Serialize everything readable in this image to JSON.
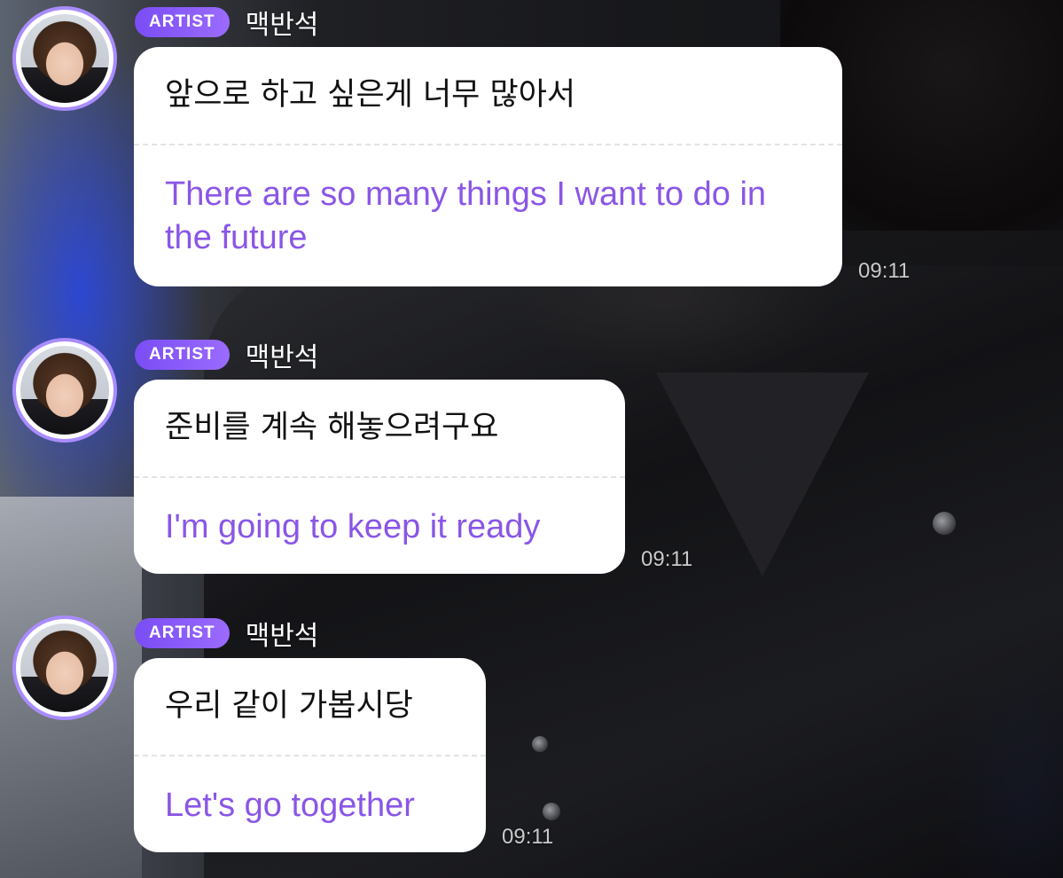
{
  "messages": [
    {
      "badge": "ARTIST",
      "sender": "맥반석",
      "original": "앞으로 하고 싶은게 너무 많아서",
      "translation": "There are so many things I want to do in the future",
      "time": "09:11",
      "avatar_icon": "artist-avatar"
    },
    {
      "badge": "ARTIST",
      "sender": "맥반석",
      "original": "준비를 계속 해놓으려구요",
      "translation": "I'm going to keep it ready",
      "time": "09:11",
      "avatar_icon": "artist-avatar"
    },
    {
      "badge": "ARTIST",
      "sender": "맥반석",
      "original": "우리 같이 가봅시당",
      "translation": "Let's go together",
      "time": "09:11",
      "avatar_icon": "artist-avatar"
    }
  ],
  "colors": {
    "badge": "#8a5cf7",
    "translation_text": "#8a56e6",
    "avatar_ring": "#a98cff",
    "bubble": "#ffffff"
  }
}
